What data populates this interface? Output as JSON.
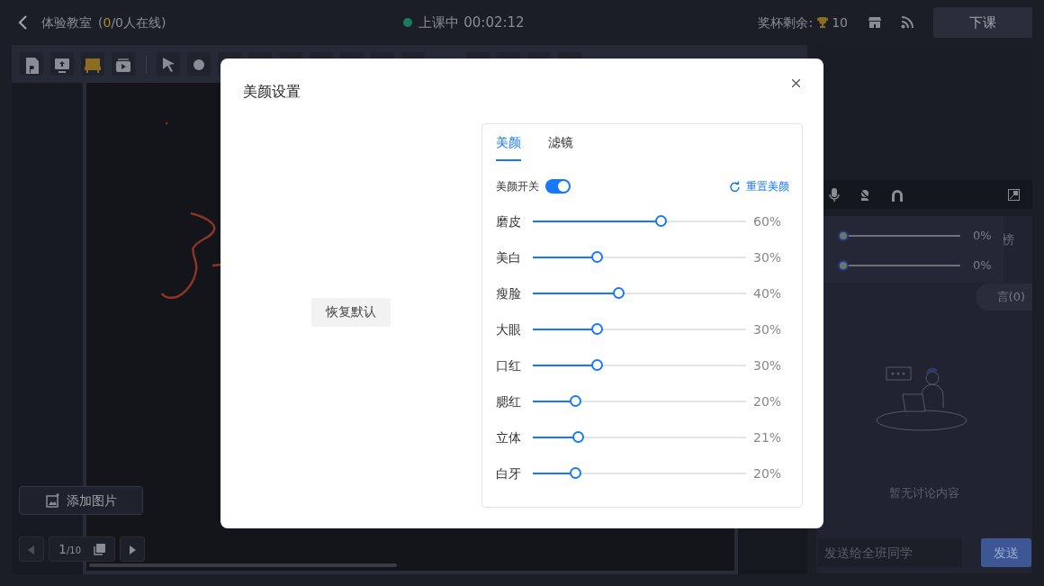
{
  "header": {
    "title": "体验教室",
    "online_prefix": "(",
    "online_count": "0",
    "online_suffix": "/0人在线)",
    "status": "上课中 00:02:12",
    "trophy_label": "奖杯剩余:",
    "trophy_count": "10",
    "end_button": "下课"
  },
  "whiteboard": {
    "add_image": "添加图片",
    "page_current": "1",
    "page_total": "/10"
  },
  "side_panel": {
    "tabs": [
      {
        "label": "榜"
      },
      {
        "label": "言(0)"
      }
    ],
    "volume_rows": [
      {
        "level": 0,
        "reading": "0%"
      },
      {
        "level": 0,
        "reading": "0%"
      }
    ],
    "empty_text": "暂无讨论内容",
    "message_placeholder": "发送给全班同学",
    "send_button": "发送"
  },
  "dialog": {
    "title": "美颜设置",
    "restore_button": "恢复默认",
    "tabs": [
      {
        "label": "美颜",
        "selected": true
      },
      {
        "label": "滤镜",
        "selected": false
      }
    ],
    "switch_label": "美颜开关",
    "switch_on": true,
    "reset_link": "重置美颜",
    "sliders": [
      {
        "label": "磨皮",
        "level": 0.6,
        "reading": "60%"
      },
      {
        "label": "美白",
        "level": 0.3,
        "reading": "30%"
      },
      {
        "label": "瘦脸",
        "level": 0.4,
        "reading": "40%"
      },
      {
        "label": "大眼",
        "level": 0.3,
        "reading": "30%"
      },
      {
        "label": "口红",
        "level": 0.3,
        "reading": "30%"
      },
      {
        "label": "腮红",
        "level": 0.2,
        "reading": "20%"
      },
      {
        "label": "立体",
        "level": 0.21,
        "reading": "21%"
      },
      {
        "label": "白牙",
        "level": 0.2,
        "reading": "20%"
      }
    ]
  }
}
